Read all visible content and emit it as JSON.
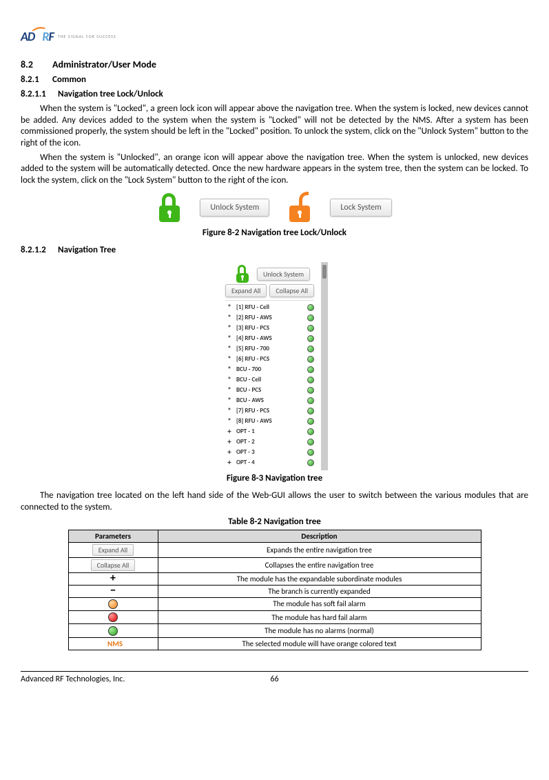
{
  "logo": {
    "tagline": "THE SIGNAL FOR SUCCESS"
  },
  "headings": {
    "h82_num": "8.2",
    "h82_title": "Administrator/User Mode",
    "h821_num": "8.2.1",
    "h821_title": "Common",
    "h8211_num": "8.2.1.1",
    "h8211_title": "Navigation tree Lock/Unlock",
    "h8212_num": "8.2.1.2",
    "h8212_title": "Navigation Tree"
  },
  "paragraphs": {
    "p1": "When the system is \"Locked\", a green lock icon will appear above the navigation tree.  When the system is locked, new devices cannot be added.  Any devices added to the system when the system is \"Locked\" will not be detected by the NMS.  After a system has been commissioned properly, the system should be left in the \"Locked\" position.  To unlock the system, click on the \"Unlock System\" button to the right of the icon.",
    "p2": "When the system is \"Unlocked\", an orange icon will appear above the navigation tree.  When the system is unlocked, new devices added to the system will be automatically detected.  Once the new hardware appears in the system tree, then the system can be locked.  To lock the system, click on the \"Lock System\" button to the right of the icon.",
    "p3": "The navigation tree located on the left hand side of the Web-GUI allows the user to switch between the various modules that are connected to the system."
  },
  "buttons": {
    "unlock": "Unlock System",
    "lock": "Lock System",
    "expand": "Expand All",
    "collapse": "Collapse All"
  },
  "captions": {
    "fig82": "Figure 8-2     Navigation tree Lock/Unlock",
    "fig83": "Figure 8-3     Navigation tree",
    "tab82": "Table 8-2      Navigation tree"
  },
  "tree": {
    "items": [
      {
        "exp": "*",
        "label": "[1] RFU - Cell",
        "dot": "green"
      },
      {
        "exp": "*",
        "label": "[2] RFU - AWS",
        "dot": "green"
      },
      {
        "exp": "*",
        "label": "[3] RFU - PCS",
        "dot": "green"
      },
      {
        "exp": "*",
        "label": "[4] RFU - AWS",
        "dot": "green"
      },
      {
        "exp": "*",
        "label": "[5] RFU - 700",
        "dot": "green"
      },
      {
        "exp": "*",
        "label": "[6] RFU - PCS",
        "dot": "green"
      },
      {
        "exp": "*",
        "label": "BCU - 700",
        "dot": "green"
      },
      {
        "exp": "*",
        "label": "BCU - Cell",
        "dot": "green"
      },
      {
        "exp": "*",
        "label": "BCU - PCS",
        "dot": "green"
      },
      {
        "exp": "*",
        "label": "BCU - AWS",
        "dot": "green"
      },
      {
        "exp": "*",
        "label": "[7] RFU - PCS",
        "dot": "green"
      },
      {
        "exp": "*",
        "label": "[8] RFU - AWS",
        "dot": "green"
      },
      {
        "exp": "+",
        "label": "OPT - 1",
        "dot": "green"
      },
      {
        "exp": "+",
        "label": "OPT - 2",
        "dot": "green"
      },
      {
        "exp": "+",
        "label": "OPT - 3",
        "dot": "green"
      },
      {
        "exp": "+",
        "label": "OPT - 4",
        "dot": "green"
      }
    ]
  },
  "table": {
    "h1": "Parameters",
    "h2": "Description",
    "rows": [
      {
        "param_type": "btn",
        "param": "Expand All",
        "desc": "Expands the entire navigation tree"
      },
      {
        "param_type": "btn",
        "param": "Collapse All",
        "desc": "Collapses the entire navigation tree"
      },
      {
        "param_type": "plus",
        "param": "+",
        "desc": "The module has the expandable subordinate modules"
      },
      {
        "param_type": "minus",
        "param": "–",
        "desc": "The branch is currently expanded"
      },
      {
        "param_type": "circle-orange",
        "param": "",
        "desc": "The module has soft fail alarm"
      },
      {
        "param_type": "circle-red",
        "param": "",
        "desc": "The module has hard fail alarm"
      },
      {
        "param_type": "circle-green",
        "param": "",
        "desc": "The module has no alarms (normal)"
      },
      {
        "param_type": "nms",
        "param": "NMS",
        "desc": "The selected module will have orange colored text"
      }
    ]
  },
  "footer": {
    "company": "Advanced RF Technologies, Inc.",
    "page": "66"
  }
}
